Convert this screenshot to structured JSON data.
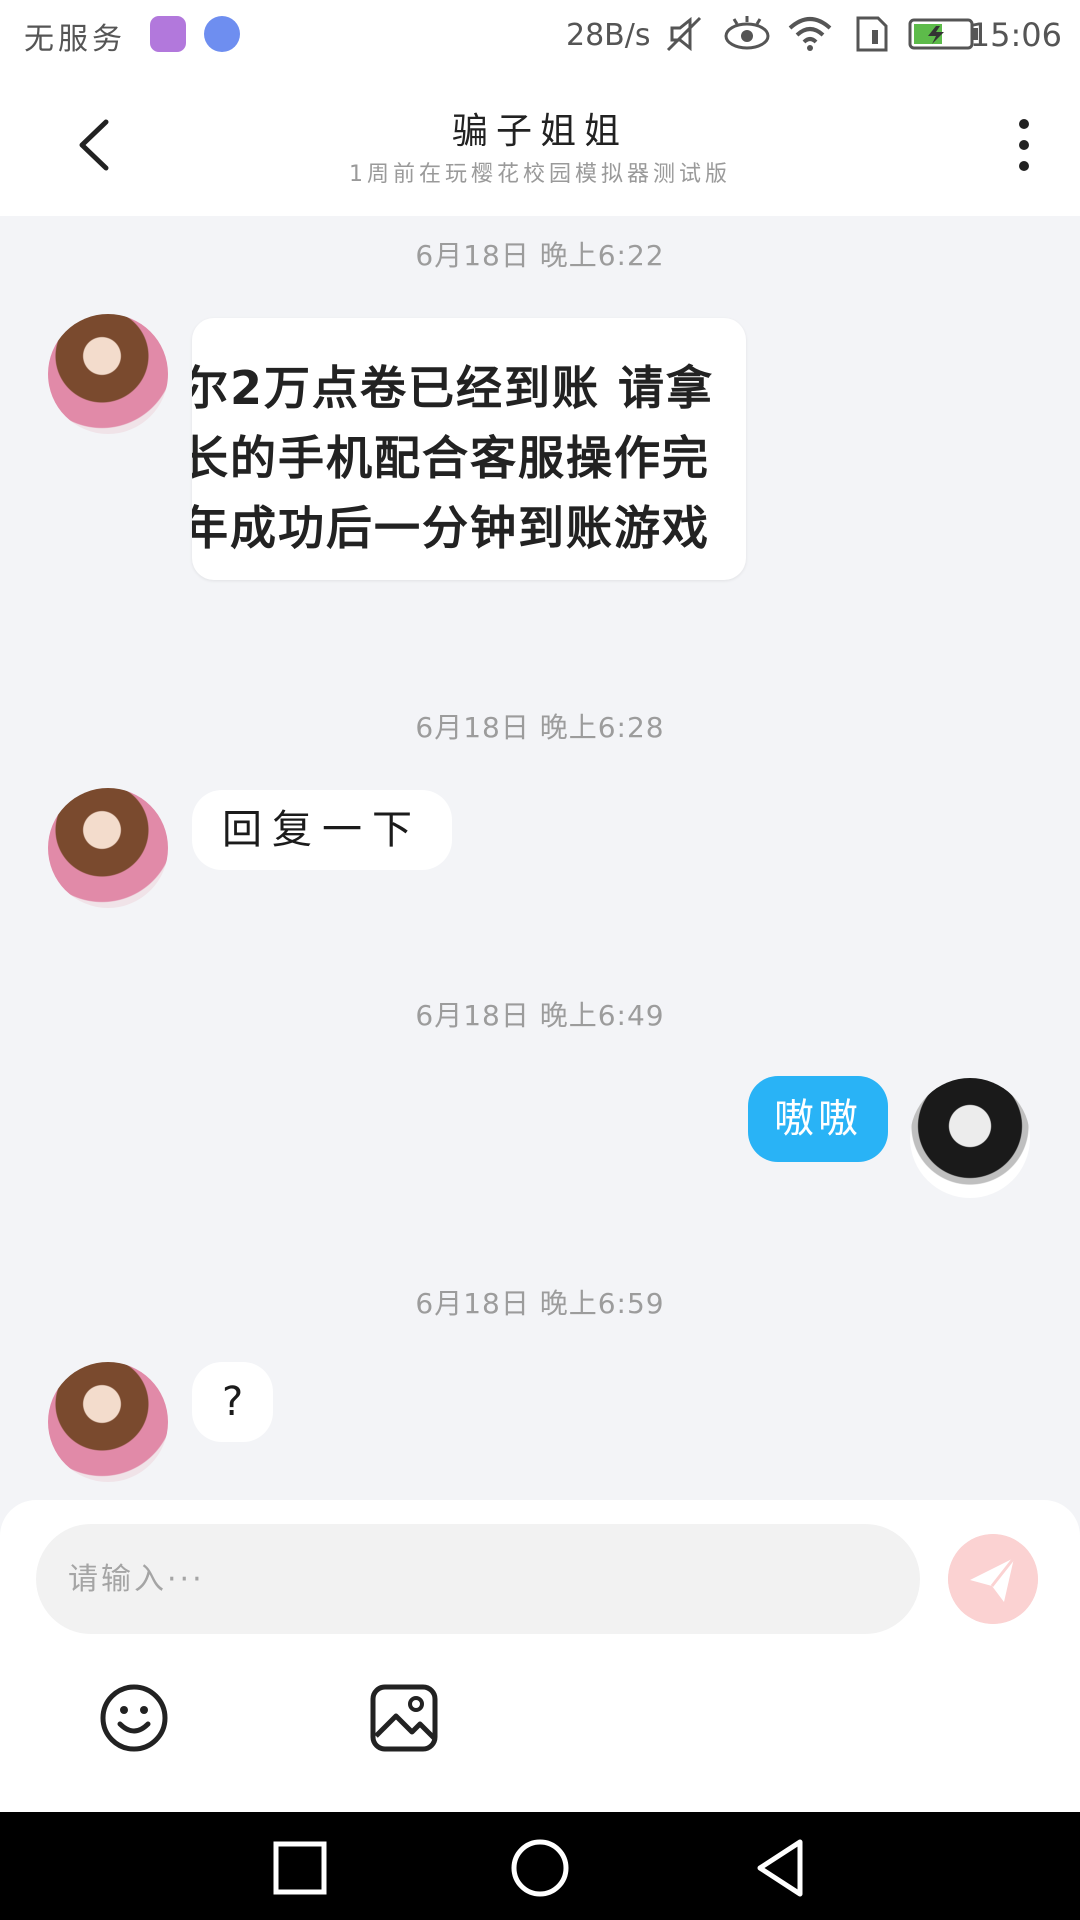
{
  "status_bar": {
    "carrier": "无服务",
    "speed": "28B/s",
    "time": "15:06"
  },
  "header": {
    "title": "骗子姐姐",
    "subtitle": "1周前在玩樱花校园模拟器测试版"
  },
  "messages": [
    {
      "timestamp": "6月18日 晚上6:22",
      "sender": "other",
      "type": "image",
      "image_text_lines": [
        "尔2万点卷已经到账 请拿",
        "长的手机配合客服操作完",
        "年成功后一分钟到账游戏"
      ]
    },
    {
      "timestamp": "6月18日 晚上6:28",
      "sender": "other",
      "type": "text",
      "text": "回复一下"
    },
    {
      "timestamp": "6月18日 晚上6:49",
      "sender": "me",
      "type": "text",
      "text": "嗷嗷"
    },
    {
      "timestamp": "6月18日 晚上6:59",
      "sender": "other",
      "type": "text",
      "text": "?"
    }
  ],
  "composer": {
    "placeholder": "请输入···"
  },
  "colors": {
    "my_bubble": "#29b3f6",
    "send_button": "#fbd2d2",
    "background": "#f3f4f7"
  }
}
